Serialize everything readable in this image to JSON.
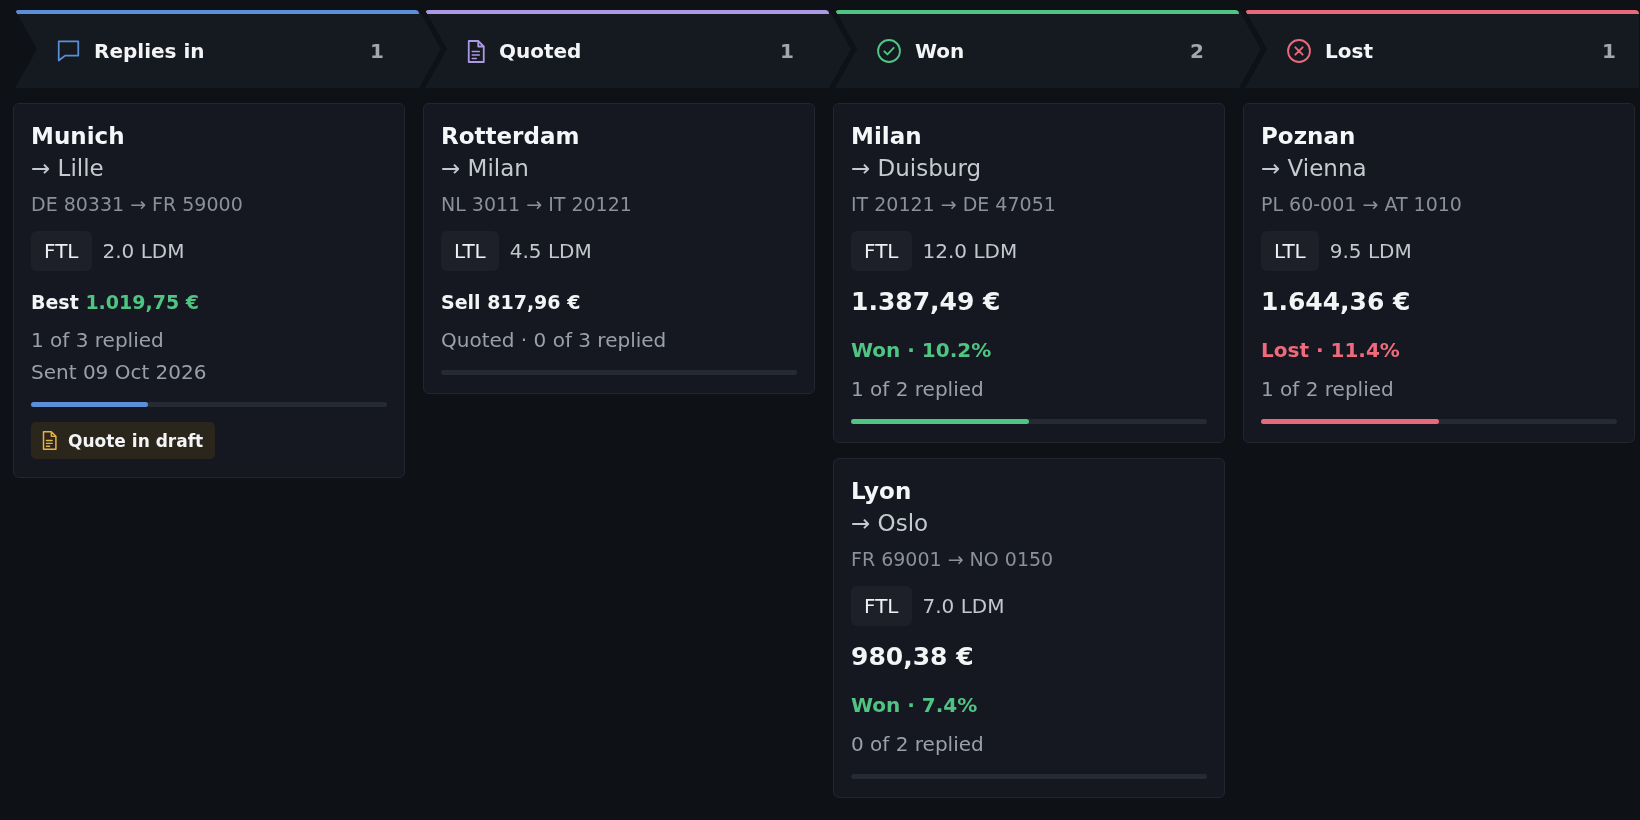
{
  "columns": [
    {
      "kind": "replies",
      "title": "Replies in",
      "count": "1",
      "color": "#5b8fd9",
      "cards": [
        {
          "origin": "Munich",
          "destination": "→ Lille",
          "postal_route": "DE 80331 → FR 59000",
          "load_type": "FTL",
          "loading_meters": "2.0 LDM",
          "price": {
            "kind": "best",
            "label": "Best",
            "value": "1.019,75 €"
          },
          "notes": [
            "1 of 3 replied",
            "Sent 09 Oct 2026"
          ],
          "level": 0.33,
          "badge": {
            "label": "Quote in draft"
          }
        }
      ]
    },
    {
      "kind": "quoted",
      "title": "Quoted",
      "count": "1",
      "color": "#ad98e4",
      "cards": [
        {
          "origin": "Rotterdam",
          "destination": "→ Milan",
          "postal_route": "NL 3011 → IT 20121",
          "load_type": "LTL",
          "loading_meters": "4.5 LDM",
          "price": {
            "kind": "sell",
            "label": "Sell",
            "value": "817,96 €"
          },
          "notes": [
            "Quoted · 0 of 3 replied"
          ],
          "level": 0
        }
      ]
    },
    {
      "kind": "won",
      "title": "Won",
      "count": "2",
      "color": "#4fc483",
      "cards": [
        {
          "origin": "Milan",
          "destination": "→ Duisburg",
          "postal_route": "IT 20121 → DE 47051",
          "load_type": "FTL",
          "loading_meters": "12.0 LDM",
          "price": {
            "kind": "final",
            "value": "1.387,49 €"
          },
          "outcome": {
            "kind": "won",
            "text": "Won · 10.2%"
          },
          "notes": [
            "1 of 2 replied"
          ],
          "level": 0.5
        },
        {
          "origin": "Lyon",
          "destination": "→ Oslo",
          "postal_route": "FR 69001 → NO 0150",
          "load_type": "FTL",
          "loading_meters": "7.0 LDM",
          "price": {
            "kind": "final",
            "value": "980,38 €"
          },
          "outcome": {
            "kind": "won",
            "text": "Won · 7.4%"
          },
          "notes": [
            "0 of 2 replied"
          ],
          "level": 0
        }
      ]
    },
    {
      "kind": "lost",
      "title": "Lost",
      "count": "1",
      "color": "#e8697a",
      "cards": [
        {
          "origin": "Poznan",
          "destination": "→ Vienna",
          "postal_route": "PL 60-001 → AT 1010",
          "load_type": "LTL",
          "loading_meters": "9.5 LDM",
          "price": {
            "kind": "final",
            "value": "1.644,36 €"
          },
          "outcome": {
            "kind": "lost",
            "text": "Lost · 11.4%"
          },
          "notes": [
            "1 of 2 replied"
          ],
          "level": 0.5
        }
      ]
    }
  ]
}
